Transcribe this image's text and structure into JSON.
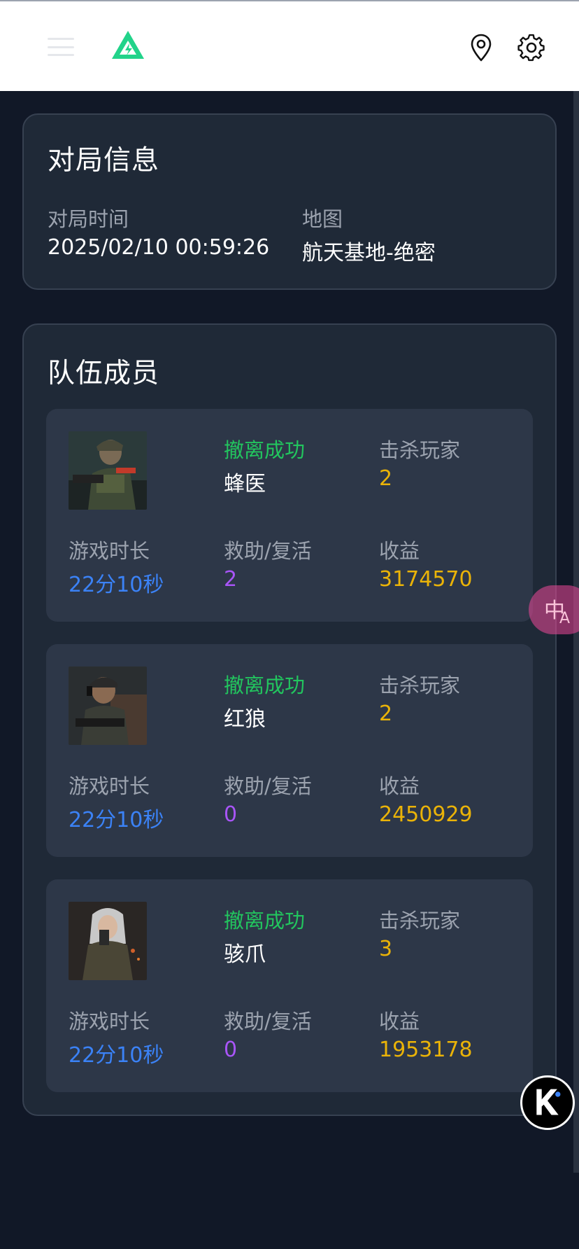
{
  "match": {
    "title": "对局信息",
    "time_label": "对局时间",
    "time_value": "2025/02/10 00:59:26",
    "map_label": "地图",
    "map_value": "航天基地-绝密"
  },
  "team": {
    "title": "队伍成员",
    "labels": {
      "kills": "击杀玩家",
      "duration": "游戏时长",
      "rescue": "救助/复活",
      "income": "收益"
    },
    "members": [
      {
        "status": "撤离成功",
        "name": "蜂医",
        "kills": "2",
        "duration": "22分10秒",
        "rescue": "2",
        "income": "3174570"
      },
      {
        "status": "撤离成功",
        "name": "红狼",
        "kills": "2",
        "duration": "22分10秒",
        "rescue": "0",
        "income": "2450929"
      },
      {
        "status": "撤离成功",
        "name": "骇爪",
        "kills": "3",
        "duration": "22分10秒",
        "rescue": "0",
        "income": "1953178"
      }
    ]
  },
  "icons": {
    "menu": "hamburger-menu-icon",
    "logo": "app-logo",
    "map_pin": "map-pin-icon",
    "settings": "gear-icon",
    "translate": "translate-icon",
    "assistant": "k-assistant-icon"
  },
  "colors": {
    "background": "#111827",
    "card": "#1f2937",
    "member_card": "#2d3748",
    "status_green": "#22c55e",
    "value_yellow": "#eab308",
    "duration_blue": "#3b82f6",
    "rescue_purple": "#a855f7",
    "logo_green": "#22d38a"
  }
}
